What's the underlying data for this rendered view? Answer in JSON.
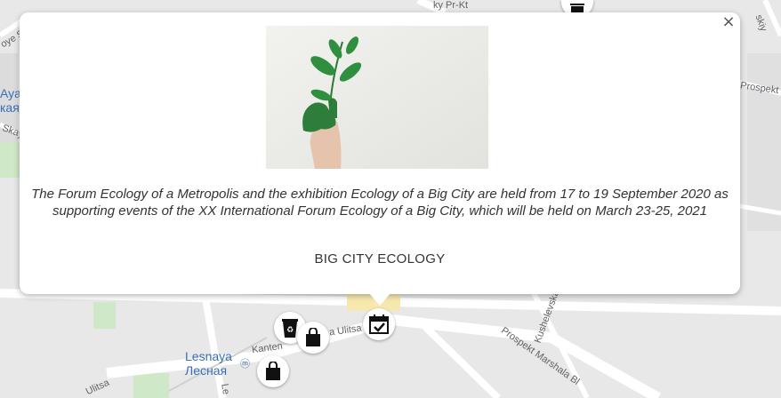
{
  "map": {
    "street_labels": [
      "ky Pr-Kt",
      "Prospekt N",
      "skiy",
      "oye S",
      "Ayaya",
      "каяя",
      "Skaya",
      "Kantemirovskaya Ulitsa",
      "a Ulitsa",
      "Kushelevskaya",
      "Prospekt Marshala Bl",
      "Ulitsa",
      "Le"
    ],
    "metro_station": {
      "latin": "Lesnaya",
      "cyrillic": "Лесная"
    }
  },
  "markers": [
    {
      "icon": "recycle-bin-icon"
    },
    {
      "icon": "shopping-bag-icon"
    },
    {
      "icon": "calendar-check-icon"
    },
    {
      "icon": "shopping-bag-icon"
    },
    {
      "icon": "trash-can-icon"
    }
  ],
  "popup": {
    "close_glyph": "×",
    "image_alt": "hand painted green holding a plant sprout",
    "description": "The Forum Ecology of a Metropolis and the exhibition Ecology of a Big City are held from 17 to 19 September 2020 as supporting events of the XX International Forum Ecology of a Big City, which will be held on March 23-25, 2021",
    "title": "BIG CITY ECOLOGY"
  },
  "colors": {
    "map_bg": "#e5e5e5",
    "road": "#ffffff",
    "park": "#c8e6c0",
    "metro_text": "#3a6fb7",
    "popup_bg": "#ffffff"
  }
}
